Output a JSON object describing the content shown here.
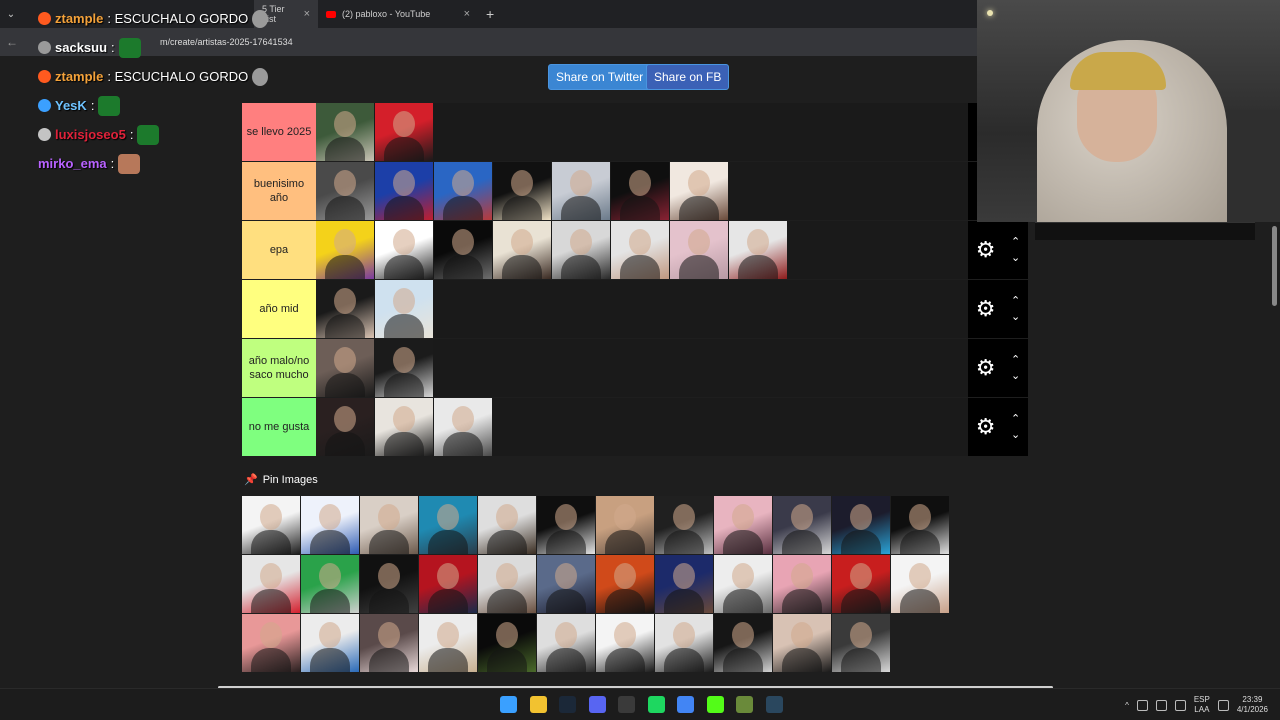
{
  "browser": {
    "tabs": [
      {
        "label": "5 Tier List",
        "active": true
      },
      {
        "label": "(2) pabloxo - YouTube",
        "active": false
      }
    ],
    "new_tab": "+",
    "close_glyph": "×",
    "menu_glyph": "⌄",
    "url": "m/create/artistas-2025-17641534"
  },
  "share": {
    "twitter": "Share on Twitter",
    "fb": "Share on FB"
  },
  "tiers": [
    {
      "label": "se llevo 2025",
      "color": "#ff7f7f",
      "items": [
        [
          "#3d5a3a",
          "#c9c4b5"
        ],
        [
          "#d41f2a",
          "#1a1a1a"
        ]
      ]
    },
    {
      "label": "buenisimo año",
      "color": "#ffbf7f",
      "items": [
        [
          "#4a4a4a",
          "#9a9a9a"
        ],
        [
          "#1c3fa8",
          "#c01e2e"
        ],
        [
          "#2a66c4",
          "#b93a3a"
        ],
        [
          "#111111",
          "#efe1c5"
        ],
        [
          "#c8ccd4",
          "#6b7a8a"
        ],
        [
          "#0f0f0f",
          "#8a2233"
        ],
        [
          "#f1e8e0",
          "#6a4a3a"
        ]
      ]
    },
    {
      "label": "epa",
      "color": "#ffdf7f",
      "items": [
        [
          "#f4d21a",
          "#7a3aa0"
        ],
        [
          "#ffffff",
          "#1b1b1b"
        ],
        [
          "#0a0a0a",
          "#6e6e6e"
        ],
        [
          "#e9e2d4",
          "#3a2a22"
        ],
        [
          "#d8d8d8",
          "#2a2a2a"
        ],
        [
          "#e4e4e4",
          "#c09880"
        ],
        [
          "#e4c2cc",
          "#b89aa4"
        ],
        [
          "#e6e6e6",
          "#8e1b1b"
        ]
      ]
    },
    {
      "label": "año mid",
      "color": "#ffff7f",
      "items": [
        [
          "#1a1a1a",
          "#d9c3b2"
        ],
        [
          "#cfe1ef",
          "#e9e4d9"
        ]
      ]
    },
    {
      "label": "año malo/no saco mucho",
      "color": "#bfff7f",
      "items": [
        [
          "#6d5e57",
          "#1a1a1a"
        ],
        [
          "#1b1b1b",
          "#d6d6d6"
        ]
      ]
    },
    {
      "label": "no me gusta",
      "color": "#7fff7f",
      "items": [
        [
          "#2a2020",
          "#1a1a1a"
        ],
        [
          "#e8e4de",
          "#1b1b1b"
        ],
        [
          "#e9e9e9",
          "#4a4a4a"
        ]
      ]
    }
  ],
  "controls": {
    "gear": "⚙",
    "up": "⌃",
    "down": "⌄"
  },
  "pin": {
    "title": "Pin Images",
    "icon": "📌"
  },
  "pool": [
    [
      "#f4f4f4",
      "#1c1c1c"
    ],
    [
      "#eef2fb",
      "#2e5bb3"
    ],
    [
      "#d9cfc6",
      "#6c5a4c"
    ],
    [
      "#1f8ab2",
      "#2a3c4a"
    ],
    [
      "#dedede",
      "#3b2e22"
    ],
    [
      "#0f0f0f",
      "#e4e4e4"
    ],
    [
      "#c8a080",
      "#5a4a40"
    ],
    [
      "#202020",
      "#c2c2c2"
    ],
    [
      "#e8b4c0",
      "#5a3040"
    ],
    [
      "#3a3a4a",
      "#d8d8d8"
    ],
    [
      "#1c1c2c",
      "#2aa4d8"
    ],
    [
      "#0f0f0f",
      "#e0e0e0"
    ],
    [
      "#e6e6e6",
      "#d4202e"
    ],
    [
      "#2aa24a",
      "#cfcfcf"
    ],
    [
      "#111111",
      "#404040"
    ],
    [
      "#b5141f",
      "#1a2a4a"
    ],
    [
      "#dbdbdb",
      "#6a5040"
    ],
    [
      "#5a6a8a",
      "#1a1a2a"
    ],
    [
      "#d04a1a",
      "#111111"
    ],
    [
      "#1c2a6a",
      "#6a4a3a"
    ],
    [
      "#ededed",
      "#6a6a6a"
    ],
    [
      "#e8a4b4",
      "#3a2a30"
    ],
    [
      "#c81e1e",
      "#1a1a1a"
    ],
    [
      "#f4f4f4",
      "#c8a088"
    ],
    [
      "#e89898",
      "#2a2020"
    ],
    [
      "#ececec",
      "#2a6ab8"
    ],
    [
      "#5a4a4a",
      "#e8d8d8"
    ],
    [
      "#ececec",
      "#c8b090"
    ],
    [
      "#0a0a0a",
      "#4a6a2a"
    ],
    [
      "#dedede",
      "#2a2a2a"
    ],
    [
      "#f4f4f4",
      "#1a1a1a"
    ],
    [
      "#e2e2e2",
      "#1a1a1a"
    ],
    [
      "#161616",
      "#d2d2d2"
    ],
    [
      "#d8c2b4",
      "#1a1a1a"
    ],
    [
      "#3a3a3a",
      "#d8d8d8"
    ]
  ],
  "chat": [
    {
      "name": "ztample",
      "name_color": "#f4a23a",
      "icon_color": "#ff5a1f",
      "message": ": ESCUCHALO GORDO",
      "emote": "skull"
    },
    {
      "name": "sacksuu",
      "name_color": "#ffffff",
      "icon_color": "#9a9a9a",
      "message": ":",
      "emote": "green"
    },
    {
      "name": "ztample",
      "name_color": "#f4a23a",
      "icon_color": "#ff5a1f",
      "message": ": ESCUCHALO GORDO",
      "emote": "skull"
    },
    {
      "name": "YesK",
      "name_color": "#6fc3ff",
      "icon_color": "#3ba0ff",
      "message": ":",
      "emote": "green"
    },
    {
      "name": "luxisjoseo5",
      "name_color": "#e0223a",
      "icon_color": "#c4c4c4",
      "message": ":",
      "emote": "green"
    },
    {
      "name": "mirko_ema",
      "name_color": "#b862ff",
      "icon_color": "",
      "message": ":",
      "emote": "face"
    }
  ],
  "taskbar": {
    "lang_top": "ESP",
    "lang_bottom": "LAA",
    "time": "23:39",
    "date": "4/1/2026",
    "tray_up": "^",
    "icons": [
      {
        "name": "windows-start",
        "color": "#3aa0ff"
      },
      {
        "name": "file-explorer",
        "color": "#f2c230"
      },
      {
        "name": "steam",
        "color": "#1b2838"
      },
      {
        "name": "discord",
        "color": "#5865f2"
      },
      {
        "name": "obs",
        "color": "#3a3a3a"
      },
      {
        "name": "spotify",
        "color": "#1ed760"
      },
      {
        "name": "chrome",
        "color": "#4285f4"
      },
      {
        "name": "kick",
        "color": "#53fc18"
      },
      {
        "name": "minecraft",
        "color": "#6a8a3a"
      },
      {
        "name": "steam-2",
        "color": "#2a475e"
      }
    ]
  }
}
